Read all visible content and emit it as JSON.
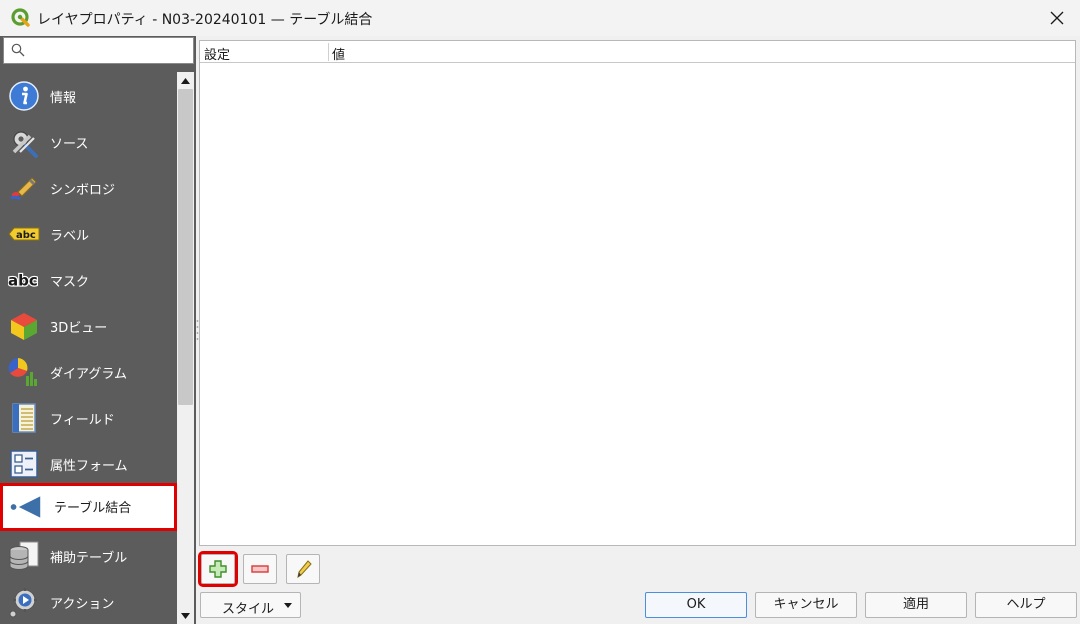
{
  "window": {
    "title": "レイヤプロパティ - N03-20240101 — テーブル結合"
  },
  "search": {
    "placeholder": "",
    "value": ""
  },
  "sidebar": {
    "items": [
      {
        "label": "情報",
        "icon": "info-icon"
      },
      {
        "label": "ソース",
        "icon": "tools-icon"
      },
      {
        "label": "シンボロジ",
        "icon": "paintbrush-icon"
      },
      {
        "label": "ラベル",
        "icon": "label-abc-icon"
      },
      {
        "label": "マスク",
        "icon": "mask-abc-icon"
      },
      {
        "label": "3Dビュー",
        "icon": "3d-cube-icon"
      },
      {
        "label": "ダイアグラム",
        "icon": "diagram-icon"
      },
      {
        "label": "フィールド",
        "icon": "fields-icon"
      },
      {
        "label": "属性フォーム",
        "icon": "attribute-form-icon"
      },
      {
        "label": "テーブル結合",
        "icon": "join-icon",
        "selected": true
      },
      {
        "label": "補助テーブル",
        "icon": "auxiliary-storage-icon"
      },
      {
        "label": "アクション",
        "icon": "action-gear-icon"
      }
    ]
  },
  "joins_table": {
    "columns": [
      "設定",
      "値"
    ],
    "rows": []
  },
  "toolbar": {
    "add_icon": "plus-icon",
    "remove_icon": "minus-icon",
    "edit_icon": "pencil-icon"
  },
  "footer": {
    "style_label": "スタイル",
    "ok_label": "OK",
    "cancel_label": "キャンセル",
    "apply_label": "適用",
    "help_label": "ヘルプ"
  },
  "colors": {
    "sidebar_bg": "#5c5c5c",
    "highlight": "#e00000",
    "primary_border": "#4a8ee0"
  }
}
